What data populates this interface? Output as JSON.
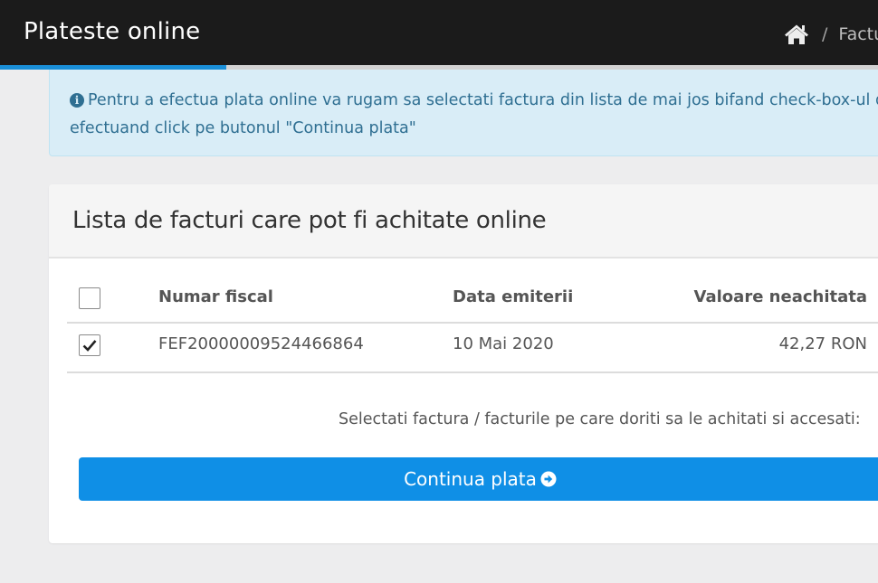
{
  "header": {
    "app_title": "Plateste online",
    "breadcrumb": {
      "home_icon": "home-icon",
      "separator": "/",
      "current": "Factu"
    },
    "progress": 0.258
  },
  "alert": {
    "icon": "info-icon",
    "line1": "Pentru a efectua plata online va rugam sa selectati factura din lista de mai jos bifand check-box-ul din d",
    "line2": "efectuand click pe butonul \"Continua plata\""
  },
  "panel": {
    "title": "Lista de facturi care pot fi achitate online",
    "columns": {
      "select_all_checked": false,
      "fiscal": "Numar fiscal",
      "date": "Data emiterii",
      "value": "Valoare neachitata"
    },
    "rows": [
      {
        "checked": true,
        "fiscal": "FEF20000009524466864",
        "date": "10 Mai 2020",
        "value": "42,27 RON"
      }
    ],
    "hint": "Selectati factura / facturile pe care doriti sa le achitati si accesati:",
    "button_label": "Continua plata",
    "button_icon": "arrow-circle-right-icon"
  },
  "colors": {
    "topbar": "#1b1b1b",
    "progress_fill": "#1a8fd8",
    "alert_bg": "#d9edf7",
    "alert_text": "#2f6f92",
    "button": "#0f8fe6"
  }
}
